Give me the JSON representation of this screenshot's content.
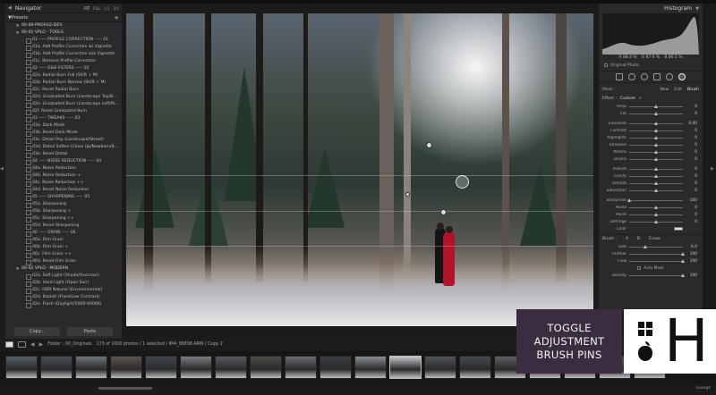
{
  "navigator": {
    "title": "Navigator",
    "options": [
      "FIT",
      "FILL",
      "1:1",
      "3:1"
    ]
  },
  "presets": {
    "title": "Presets",
    "add_label": "+",
    "items": [
      {
        "type": "folder",
        "label": "00-00-PROFILE-DEV"
      },
      {
        "type": "folder",
        "label": "00-01 VPLO - TOOLS"
      },
      {
        "type": "leaf",
        "label": "01 ----- PROFILE CORRECTION ----- 01"
      },
      {
        "type": "leaf",
        "label": "01a. Add Profile Correction w/ Vignette"
      },
      {
        "type": "leaf",
        "label": "01b. Add Profile Correction w/o Vignette"
      },
      {
        "type": "leaf",
        "label": "01c. Remove Profile Correction"
      },
      {
        "type": "leaf",
        "label": "02 ----- D&B FILTERS ----- 02"
      },
      {
        "type": "leaf",
        "label": "02a. Radial Burn Full (Shift + M)"
      },
      {
        "type": "leaf",
        "label": "02b. Radial Burn Narrow (Shift + M)"
      },
      {
        "type": "leaf",
        "label": "02c. Reset Radial Burn"
      },
      {
        "type": "leaf",
        "label": "02d. Graduated Burn (Landscape Top/B..."
      },
      {
        "type": "leaf",
        "label": "02e. Graduated Burn (Landscape Left/Ri..."
      },
      {
        "type": "leaf",
        "label": "02f. Reset Graduated Burn"
      },
      {
        "type": "leaf",
        "label": "03 ----- TWEAKS ----- 03"
      },
      {
        "type": "leaf",
        "label": "03a. Dark Mode"
      },
      {
        "type": "leaf",
        "label": "03b. Reset Dark Mode"
      },
      {
        "type": "leaf",
        "label": "03c. Detail Pop (Landscape/Street)"
      },
      {
        "type": "leaf",
        "label": "03d. Detail Soften (Close Up/Newborn/B..."
      },
      {
        "type": "leaf",
        "label": "03e. Reset Detail"
      },
      {
        "type": "leaf",
        "label": "04 ----- NOISE REDUCTION ----- 04"
      },
      {
        "type": "leaf",
        "label": "04a. Noise Reduction"
      },
      {
        "type": "leaf",
        "label": "04b. Noise Reduction +"
      },
      {
        "type": "leaf",
        "label": "04c. Noise Reduction ++"
      },
      {
        "type": "leaf",
        "label": "04d. Reset Noise Reduction"
      },
      {
        "type": "leaf",
        "label": "05 ----- SHARPENING ----- 05"
      },
      {
        "type": "leaf",
        "label": "05a. Sharpening"
      },
      {
        "type": "leaf",
        "label": "05b. Sharpening +"
      },
      {
        "type": "leaf",
        "label": "05c. Sharpening ++"
      },
      {
        "type": "leaf",
        "label": "05d. Reset Sharpening"
      },
      {
        "type": "leaf",
        "label": "06 ----- GRAIN ----- 06"
      },
      {
        "type": "leaf",
        "label": "06a. Film Grain"
      },
      {
        "type": "leaf",
        "label": "06b. Film Grain +"
      },
      {
        "type": "leaf",
        "label": "06c. Film Grain ++"
      },
      {
        "type": "leaf",
        "label": "06d. Reset Film Grain"
      },
      {
        "type": "folder",
        "label": "00-02 VPLO - MODERN"
      },
      {
        "type": "leaf",
        "label": "02a. Soft Light (Shade/Overcast)"
      },
      {
        "type": "leaf",
        "label": "02b. Hard Light (Open Sun)"
      },
      {
        "type": "leaf",
        "label": "02c. HDR Natural (Environmental)"
      },
      {
        "type": "leaf",
        "label": "02d. Backlit (Flare/Low Contrast)"
      },
      {
        "type": "leaf",
        "label": "02e. Flash (Daylight/5000-6000K)"
      }
    ]
  },
  "buttons": {
    "copy": "Copy...",
    "paste": "Paste"
  },
  "histogram": {
    "title": "Histogram",
    "readout": [
      "R 88.4 %",
      "G 87.6 %",
      "B 86.1 %"
    ],
    "original_photo": "Original Photo"
  },
  "mask": {
    "label": "Mask :",
    "options": [
      "New",
      "Edit",
      "Brush"
    ],
    "active": "Brush"
  },
  "effect": {
    "label": "Effect :",
    "value": "Custom"
  },
  "sliders_group1": [
    {
      "label": "Temp",
      "value": "0",
      "pos": 0.5
    },
    {
      "label": "Tint",
      "value": "0",
      "pos": 0.5
    }
  ],
  "sliders_group2": [
    {
      "label": "Exposure",
      "value": "0.00",
      "pos": 0.5
    },
    {
      "label": "Contrast",
      "value": "0",
      "pos": 0.5
    },
    {
      "label": "Highlights",
      "value": "0",
      "pos": 0.5
    },
    {
      "label": "Shadows",
      "value": "0",
      "pos": 0.5
    },
    {
      "label": "Whites",
      "value": "0",
      "pos": 0.5
    },
    {
      "label": "Blacks",
      "value": "0",
      "pos": 0.5
    }
  ],
  "sliders_group3": [
    {
      "label": "Texture",
      "value": "0",
      "pos": 0.5
    },
    {
      "label": "Clarity",
      "value": "0",
      "pos": 0.5
    },
    {
      "label": "Dehaze",
      "value": "0",
      "pos": 0.5
    },
    {
      "label": "Saturation",
      "value": "0",
      "pos": 0.5
    }
  ],
  "sliders_group4": [
    {
      "label": "Sharpness",
      "value": "-100",
      "pos": 0.0
    },
    {
      "label": "Noise",
      "value": "0",
      "pos": 0.5
    },
    {
      "label": "Moiré",
      "value": "0",
      "pos": 0.5
    },
    {
      "label": "Defringe",
      "value": "0",
      "pos": 0.5
    }
  ],
  "color_label": "Color",
  "brush": {
    "label": "Brush :",
    "tabs": [
      "A",
      "B",
      "Erase"
    ],
    "sliders": [
      {
        "label": "Size",
        "value": "6.0",
        "pos": 0.3
      },
      {
        "label": "Feather",
        "value": "100",
        "pos": 1.0
      },
      {
        "label": "Flow",
        "value": "100",
        "pos": 1.0
      }
    ],
    "auto_mask": "Auto Mask",
    "density": {
      "label": "Density",
      "value": "100",
      "pos": 1.0
    }
  },
  "folder_bar": {
    "text": "Folder : 00_Originals",
    "count": "173 of 1000 photos / 1 selected / IM4_06898.ARW / Copy 2"
  },
  "filmstrip_count": 19,
  "filmstrip_selected": 11,
  "status_right": "Lounge",
  "overlay": {
    "line1": "TOGGLE",
    "line2": "ADJUSTMENT",
    "line3": "BRUSH PINS",
    "hotkey": "H"
  },
  "colors": {
    "panel": "#2a2a2a",
    "overlay_bg": "#3a2d3f",
    "dress": "#b2122a"
  }
}
